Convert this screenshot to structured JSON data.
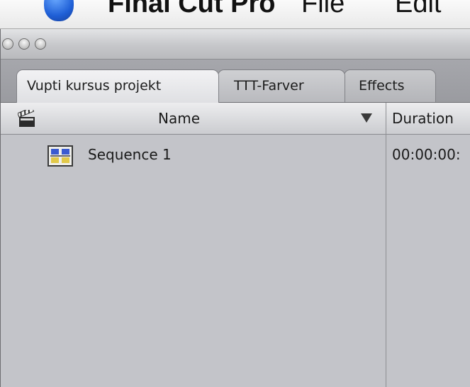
{
  "menubar": {
    "app_name": "Final Cut Pro",
    "file_label": "File",
    "edit_label": "Edit"
  },
  "tabs": [
    {
      "label": "Vupti kursus projekt",
      "active": true
    },
    {
      "label": "TTT-Farver",
      "active": false
    },
    {
      "label": "Effects",
      "active": false
    }
  ],
  "browser": {
    "columns": {
      "name_header": "Name",
      "duration_header": "Duration"
    },
    "rows": [
      {
        "name": "Sequence 1",
        "duration": "00:00:00:"
      }
    ]
  },
  "colors": {
    "accent_blue": "#1f5fd6",
    "list_background": "#c3c4c9",
    "header_background": "#d8d9dc"
  },
  "icons": {
    "header_icon": "clapperboard-icon",
    "row_icon": "sequence-icon"
  }
}
